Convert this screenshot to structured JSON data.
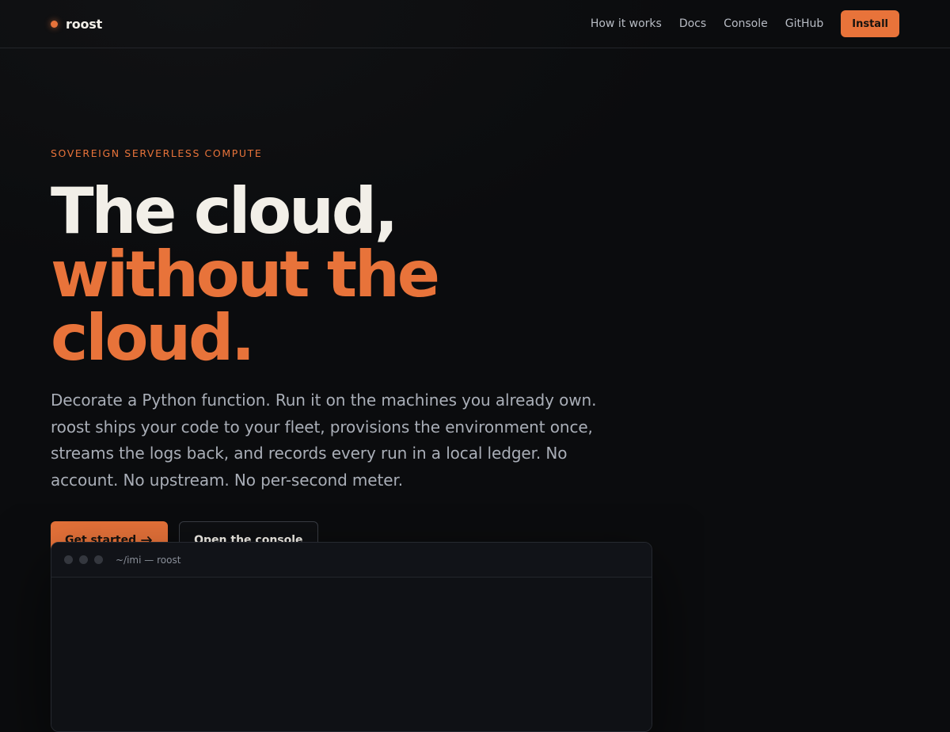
{
  "header": {
    "brand": "roost",
    "nav": [
      "How it works",
      "Docs",
      "Console",
      "GitHub"
    ],
    "install_label": "Install"
  },
  "hero": {
    "eyebrow": "SOVEREIGN SERVERLESS COMPUTE",
    "headline_line1": "The cloud,",
    "headline_line2": "without the cloud.",
    "lede": "Decorate a Python function. Run it on the machines you already own. roost ships your code to your fleet, provisions the environment once, streams the logs back, and records every run in a local ledger. No account. No upstream. No per-second meter.",
    "primary_cta": "Get started",
    "primary_cta_icon": "arrow-right-icon",
    "secondary_cta": "Open the console"
  },
  "terminal": {
    "title": "~/imi — roost"
  },
  "colors": {
    "accent": "#e8733a",
    "background": "#0b0c0e",
    "text": "#f2efe8",
    "muted": "#a9aeb7"
  }
}
